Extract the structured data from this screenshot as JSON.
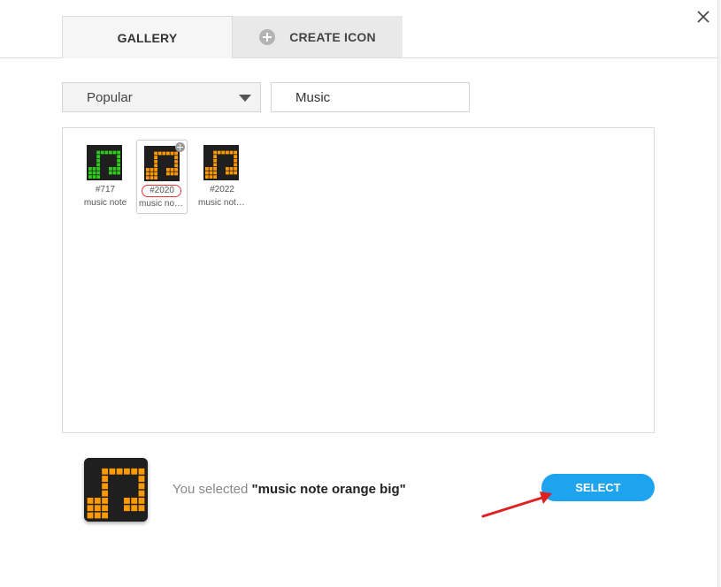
{
  "tabs": [
    {
      "label": "GALLERY",
      "active": true
    },
    {
      "label": "CREATE ICON",
      "active": false,
      "icon": "plus-circle-icon"
    }
  ],
  "filter": {
    "selected": "Popular"
  },
  "search": {
    "value": "Music"
  },
  "gallery": {
    "items": [
      {
        "id": "#717",
        "name": "music note",
        "color": "#2ecc1b",
        "selected": false
      },
      {
        "id": "#2020",
        "name": "music note orange big",
        "color": "#ff9900",
        "selected": true
      },
      {
        "id": "#2022",
        "name": "music note orange",
        "color": "#ff9900",
        "selected": false
      }
    ]
  },
  "selection": {
    "prefix": "You selected ",
    "name": "\"music note orange big\""
  },
  "actions": {
    "select_label": "SELECT"
  },
  "colors": {
    "accent": "#1ea3ee",
    "annotation": "#e02020",
    "tile_bg": "#1f1f1f"
  }
}
